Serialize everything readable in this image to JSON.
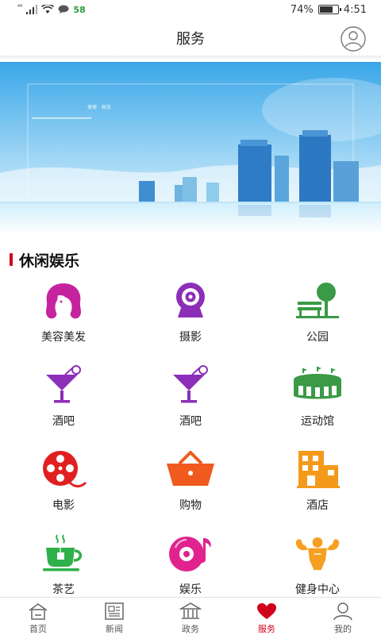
{
  "status_bar": {
    "network": "⁴⁶",
    "notif_count": "58",
    "battery_percent": "74%",
    "battery_level": 0.74,
    "time": "4:51"
  },
  "header": {
    "title": "服务",
    "profile_icon": "user-circle-icon"
  },
  "banner": {
    "slogan": "便捷 · 高效",
    "theme_color": "#3aa6e8"
  },
  "section": {
    "title": "休闲娱乐",
    "accent": "#d0021b"
  },
  "services": [
    {
      "label": "美容美发",
      "icon": "beauty-salon-icon",
      "color": "#c6239f"
    },
    {
      "label": "摄影",
      "icon": "camera-icon",
      "color": "#8c2fb8"
    },
    {
      "label": "公园",
      "icon": "park-icon",
      "color": "#3a9a45"
    },
    {
      "label": "酒吧",
      "icon": "cocktail-icon",
      "color": "#8c2fb8"
    },
    {
      "label": "酒吧",
      "icon": "cocktail-icon",
      "color": "#8c2fb8"
    },
    {
      "label": "运动馆",
      "icon": "stadium-icon",
      "color": "#3a9a45"
    },
    {
      "label": "电影",
      "icon": "film-reel-icon",
      "color": "#e02020"
    },
    {
      "label": "购物",
      "icon": "shopping-basket-icon",
      "color": "#f05a1e"
    },
    {
      "label": "酒店",
      "icon": "hotel-icon",
      "color": "#f39a1a"
    },
    {
      "label": "茶艺",
      "icon": "tea-cup-icon",
      "color": "#2fb04a"
    },
    {
      "label": "娱乐",
      "icon": "music-disc-icon",
      "color": "#e0238f"
    },
    {
      "label": "健身中心",
      "icon": "bodybuilder-icon",
      "color": "#f5a020"
    }
  ],
  "bottom_nav": [
    {
      "label": "首页",
      "icon": "home-icon"
    },
    {
      "label": "新闻",
      "icon": "newspaper-icon"
    },
    {
      "label": "政务",
      "icon": "government-building-icon"
    },
    {
      "label": "服务",
      "icon": "heart-icon",
      "active": true
    },
    {
      "label": "我的",
      "icon": "user-icon"
    }
  ]
}
